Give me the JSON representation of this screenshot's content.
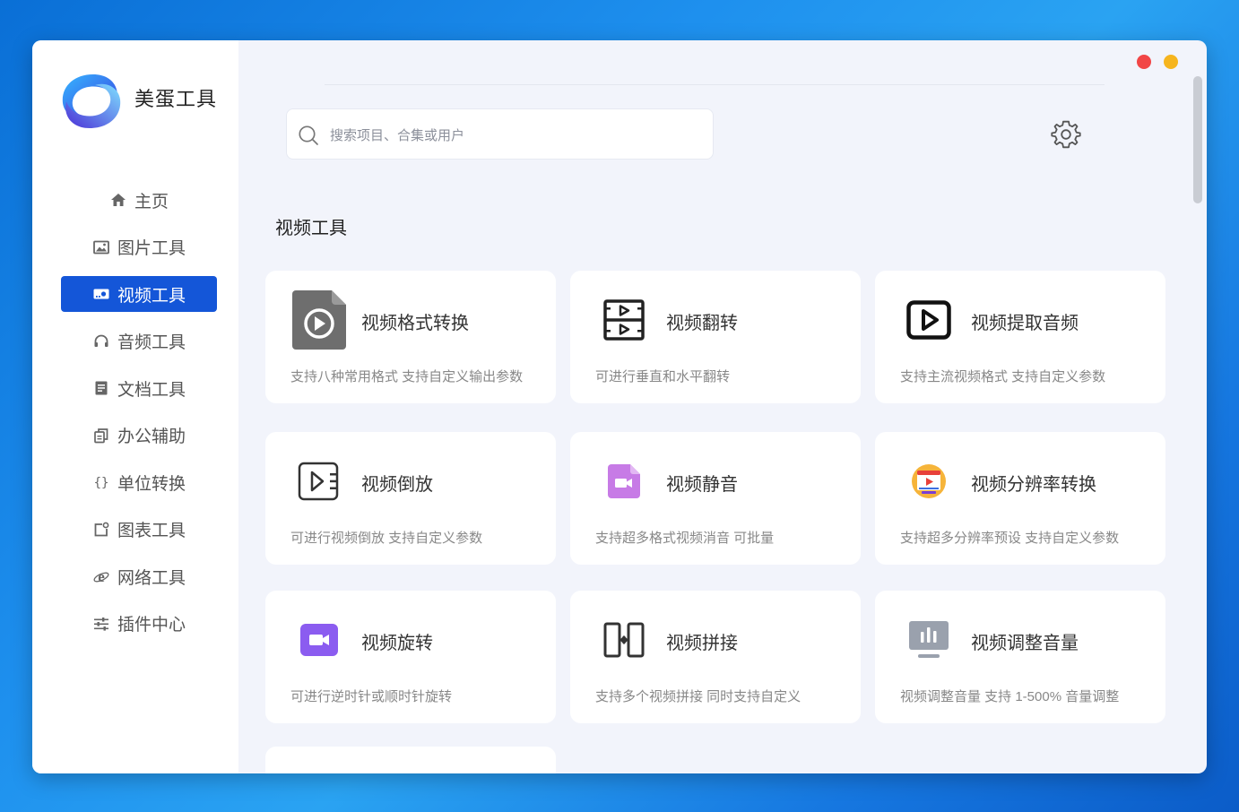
{
  "app": {
    "brand": "美蛋工具"
  },
  "sidebar": {
    "items": [
      {
        "label": "主页",
        "icon": "home-icon",
        "active": false
      },
      {
        "label": "图片工具",
        "icon": "image-icon",
        "active": false
      },
      {
        "label": "视频工具",
        "icon": "video-icon",
        "active": true
      },
      {
        "label": "音频工具",
        "icon": "headphones-icon",
        "active": false
      },
      {
        "label": "文档工具",
        "icon": "document-icon",
        "active": false
      },
      {
        "label": "办公辅助",
        "icon": "copy-icon",
        "active": false
      },
      {
        "label": "单位转换",
        "icon": "braces-icon",
        "active": false
      },
      {
        "label": "图表工具",
        "icon": "chart-icon",
        "active": false
      },
      {
        "label": "网络工具",
        "icon": "browser-icon",
        "active": false
      },
      {
        "label": "插件中心",
        "icon": "sliders-icon",
        "active": false
      }
    ]
  },
  "search": {
    "placeholder": "搜索项目、合集或用户",
    "value": ""
  },
  "section": {
    "title": "视频工具"
  },
  "tools": [
    {
      "title": "视频格式转换",
      "desc": "支持八种常用格式 支持自定义输出参数",
      "icon": "video-format-icon"
    },
    {
      "title": "视频翻转",
      "desc": "可进行垂直和水平翻转",
      "icon": "video-flip-icon"
    },
    {
      "title": "视频提取音频",
      "desc": "支持主流视频格式 支持自定义参数",
      "icon": "extract-audio-icon"
    },
    {
      "title": "视频倒放",
      "desc": "可进行视频倒放 支持自定义参数",
      "icon": "video-reverse-icon"
    },
    {
      "title": "视频静音",
      "desc": "支持超多格式视频消音 可批量",
      "icon": "video-mute-icon"
    },
    {
      "title": "视频分辨率转换",
      "desc": "支持超多分辨率预设 支持自定义参数",
      "icon": "resolution-icon"
    },
    {
      "title": "视频旋转",
      "desc": "可进行逆时针或顺时针旋转",
      "icon": "video-rotate-icon"
    },
    {
      "title": "视频拼接",
      "desc": "支持多个视频拼接 同时支持自定义",
      "icon": "video-merge-icon"
    },
    {
      "title": "视频调整音量",
      "desc": "视频调整音量 支持 1-500% 音量调整",
      "icon": "volume-icon"
    }
  ],
  "colors": {
    "accent": "#1456d8",
    "close": "#f24646",
    "minimize": "#f6b51e"
  }
}
